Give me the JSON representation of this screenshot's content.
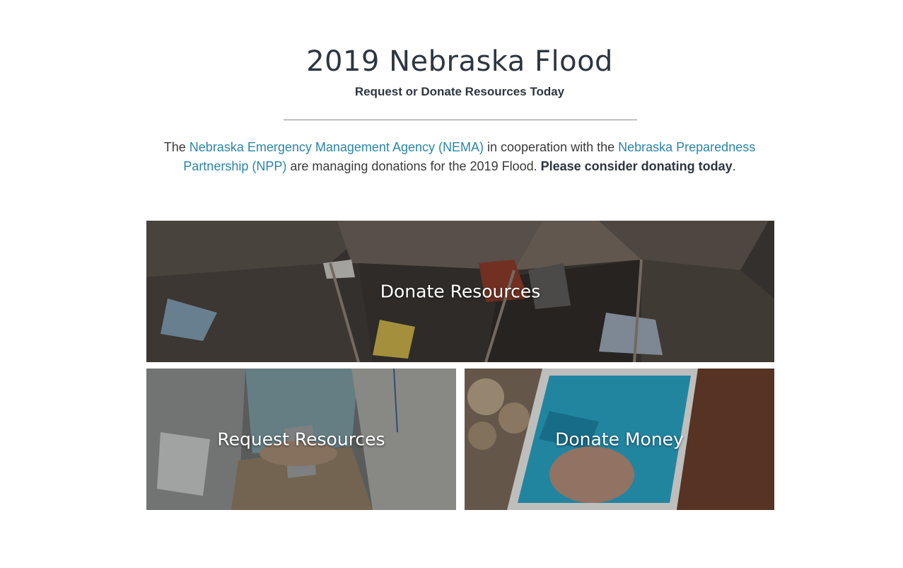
{
  "header": {
    "title": "2019 Nebraska Flood",
    "subtitle": "Request or Donate Resources Today"
  },
  "intro": {
    "text_1": "The ",
    "link_nema": "Nebraska Emergency Management Agency (NEMA)",
    "text_2": " in cooperation with the ",
    "link_npp": "Nebraska Preparedness Partnership (NPP)",
    "text_3": " are managing donations for the 2019 Flood. ",
    "emphasis": "Please consider donating today",
    "text_4": "."
  },
  "tiles": [
    {
      "label": "Donate Resources",
      "image": "cardboard-boxes-photo"
    },
    {
      "label": "Request Resources",
      "image": "hands-exchanging-goods-photo"
    },
    {
      "label": "Donate Money",
      "image": "phone-donate-photo"
    }
  ],
  "colors": {
    "link": "#2a86a8",
    "heading": "#2e3640",
    "divider": "#8a8a8a"
  }
}
